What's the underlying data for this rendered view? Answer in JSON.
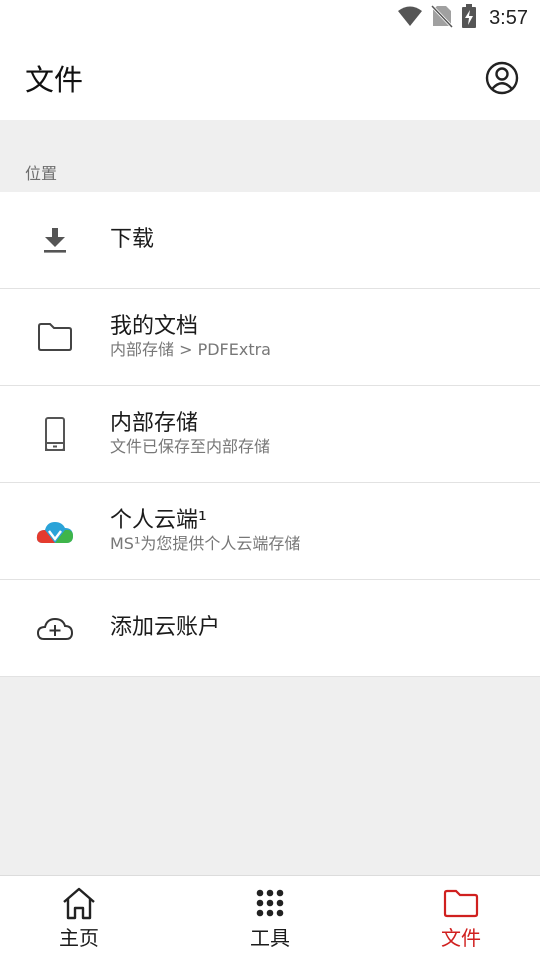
{
  "status_bar": {
    "time": "3:57"
  },
  "app_bar": {
    "title": "文件"
  },
  "section": {
    "label": "位置"
  },
  "items": [
    {
      "title": "下载",
      "subtitle": "",
      "icon": "download-icon"
    },
    {
      "title": "我的文档",
      "subtitle": "内部存储 > PDFExtra",
      "icon": "folder-icon"
    },
    {
      "title": "内部存储",
      "subtitle": "文件已保存至内部存储",
      "icon": "phone-icon"
    },
    {
      "title": "个人云端¹",
      "subtitle": "MS¹为您提供个人云端存储",
      "icon": "cloud-brand-icon"
    },
    {
      "title": "添加云账户",
      "subtitle": "",
      "icon": "cloud-add-icon"
    }
  ],
  "bottom_nav": [
    {
      "label": "主页",
      "icon": "home-icon",
      "active": false
    },
    {
      "label": "工具",
      "icon": "grid-dots-icon",
      "active": false
    },
    {
      "label": "文件",
      "icon": "folder-icon",
      "active": true
    }
  ],
  "colors": {
    "accent": "#d0201f",
    "background": "#efefef",
    "surface": "#ffffff"
  }
}
